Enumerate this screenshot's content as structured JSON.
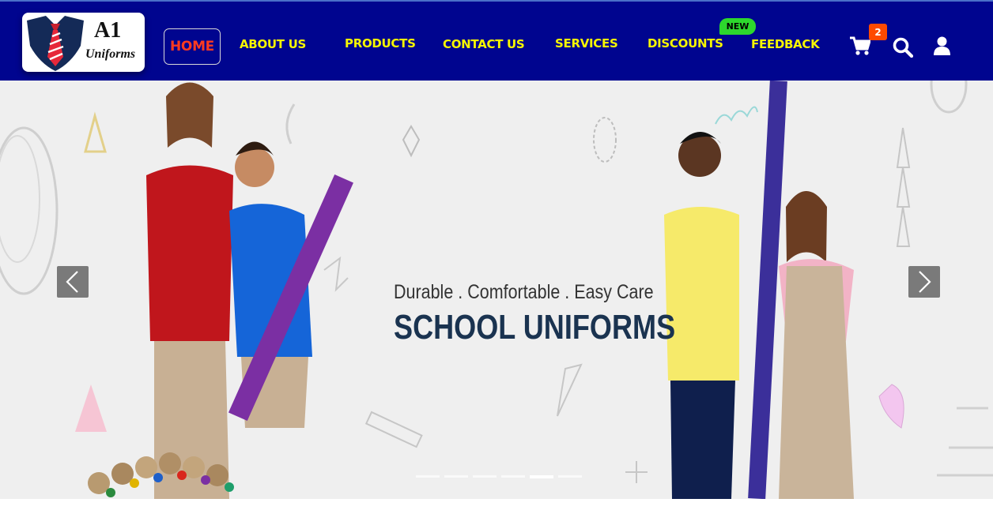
{
  "logo": {
    "line1": "A1",
    "line2": "Uniforms"
  },
  "nav": {
    "home": "HOME",
    "about": "ABOUT US",
    "products": "PRODUCTS",
    "contact": "CONTACT US",
    "services": "SERVICES",
    "discounts": "DISCOUNTS",
    "discounts_badge": "NEW",
    "feedback": "FEEDBACK"
  },
  "header_icons": {
    "cart": "cart-icon",
    "cart_count": "2",
    "search": "search-icon",
    "user": "user-icon"
  },
  "hero": {
    "tagline": "Durable . Comfortable . Easy Care",
    "title": "SCHOOL UNIFORMS",
    "slides": 6,
    "active_slide": 5
  },
  "colors": {
    "nav_bg": "#00058f",
    "nav_text": "#f7f700",
    "active_text": "#ff3b1f",
    "badge_new": "#2dd72d",
    "cart_badge": "#ff4a00",
    "hero_title": "#1a3350"
  }
}
